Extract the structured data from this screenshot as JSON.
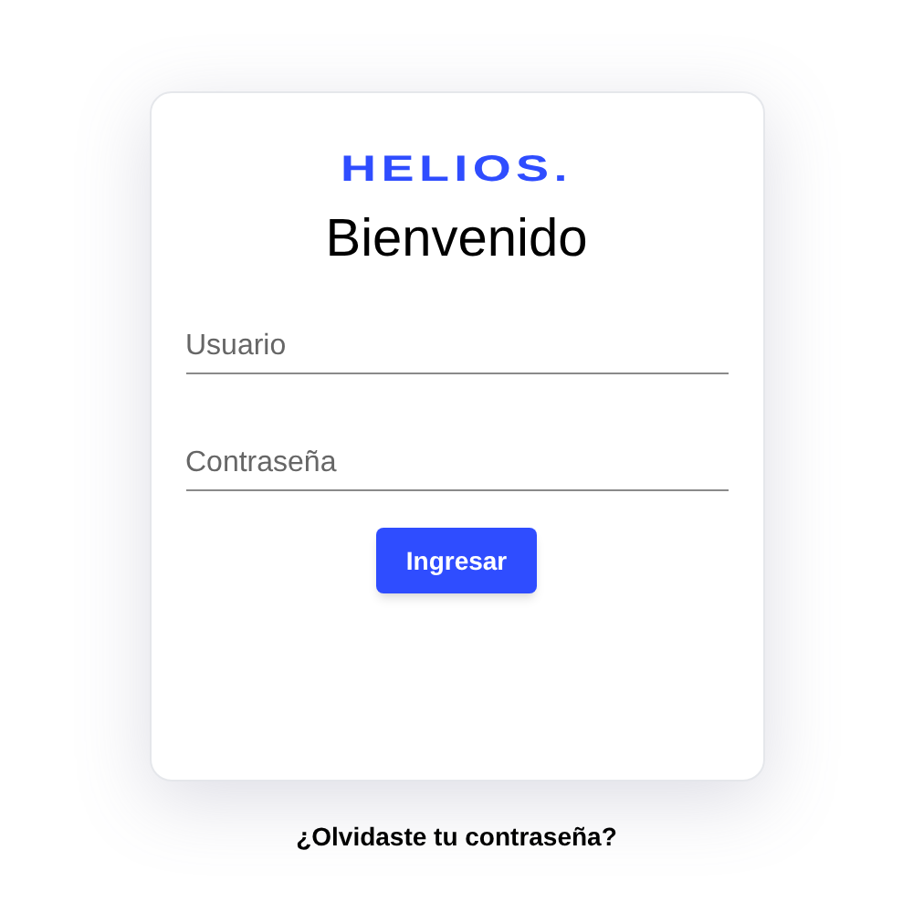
{
  "logo": "HELIOS.",
  "title": "Bienvenido",
  "fields": [
    {
      "placeholder": "Usuario"
    },
    {
      "placeholder": "Contraseña"
    }
  ],
  "submit_button": "Ingresar",
  "forgot_link": "¿Olvidaste tu contraseña?"
}
